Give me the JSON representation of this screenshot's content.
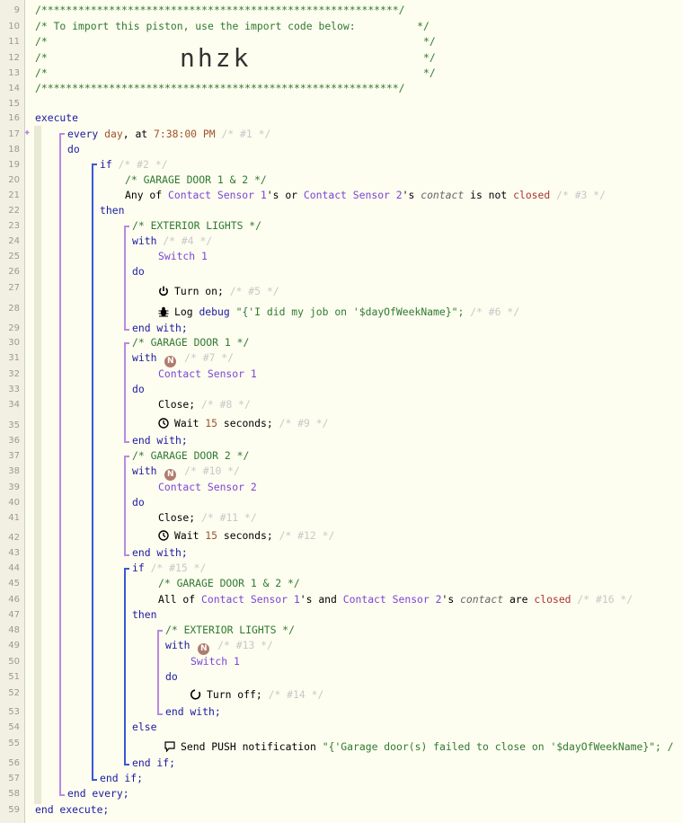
{
  "import_code": "nhzk",
  "line_numbers": [
    "9",
    "10",
    "11",
    "12",
    "13",
    "14",
    "15",
    "16",
    "17",
    "18",
    "19",
    "20",
    "21",
    "22",
    "23",
    "24",
    "25",
    "26",
    "27",
    "28",
    "29",
    "30",
    "31",
    "32",
    "33",
    "34",
    "35",
    "36",
    "37",
    "38",
    "39",
    "40",
    "41",
    "42",
    "43",
    "44",
    "45",
    "46",
    "47",
    "48",
    "49",
    "50",
    "51",
    "52",
    "53",
    "54",
    "55",
    "56",
    "57",
    "58",
    "59"
  ],
  "header": {
    "stars": "/**********************************************************/",
    "import_line": "/* To import this piston, use the import code below:          */",
    "blank": "/*                                                             */"
  },
  "code": {
    "execute": "execute",
    "every_kw": "every",
    "every_day": "day",
    "every_at": ", at ",
    "every_time": "7:38:00 PM",
    "id1": "/* #1 */",
    "do": "do",
    "if": "if",
    "id2": "/* #2 */",
    "comment_garage12": "/* GARAGE DOOR 1 & 2 */",
    "cond1_any": "Any of ",
    "dev_cs1": "Contact Sensor 1",
    "cond1_s_or": "'s or ",
    "dev_cs2": "Contact Sensor 2",
    "cond1_s": "'s ",
    "attr_contact": "contact",
    "cond1_isnot": " is not ",
    "val_closed": "closed",
    "id3": "/* #3 */",
    "then": "then",
    "comment_ext": "/* EXTERIOR LIGHTS */",
    "with": "with",
    "id4": "/* #4 */",
    "dev_sw1": "Switch 1",
    "turn_on": "Turn on;",
    "id5": "/* #5 */",
    "log": "Log ",
    "log_level": "debug",
    "log_msg": " \"{'I did my job on '$dayOfWeekName}\";",
    "id6": "/* #6 */",
    "end_with": "end with;",
    "comment_g1": "/* GARAGE DOOR 1 */",
    "id7": "/* #7 */",
    "close": "Close;",
    "id8": "/* #8 */",
    "wait": "Wait ",
    "wait_n": "15",
    "wait_unit": " seconds;",
    "id9": "/* #9 */",
    "comment_g2": "/* GARAGE DOOR 2 */",
    "id10": "/* #10 */",
    "id11": "/* #11 */",
    "id12": "/* #12 */",
    "id15": "/* #15 */",
    "cond2_all": "All of ",
    "cond2_s_and": "'s and ",
    "cond2_are": " are ",
    "id16": "/* #16 */",
    "id13": "/* #13 */",
    "turn_off": "Turn off;",
    "id14": "/* #14 */",
    "else": "else",
    "send_push": "Send PUSH notification ",
    "push_msg": "\"{'Garage door(s) failed to close on '$dayOfWeekName}\"; /",
    "end_if": "end if;",
    "end_every": "end every;",
    "end_execute": "end execute;",
    "n_badge": "N"
  },
  "icons": [
    "power-icon",
    "bug-icon",
    "clock-icon",
    "power-off-icon",
    "comment-icon",
    "puzzle-icon"
  ]
}
